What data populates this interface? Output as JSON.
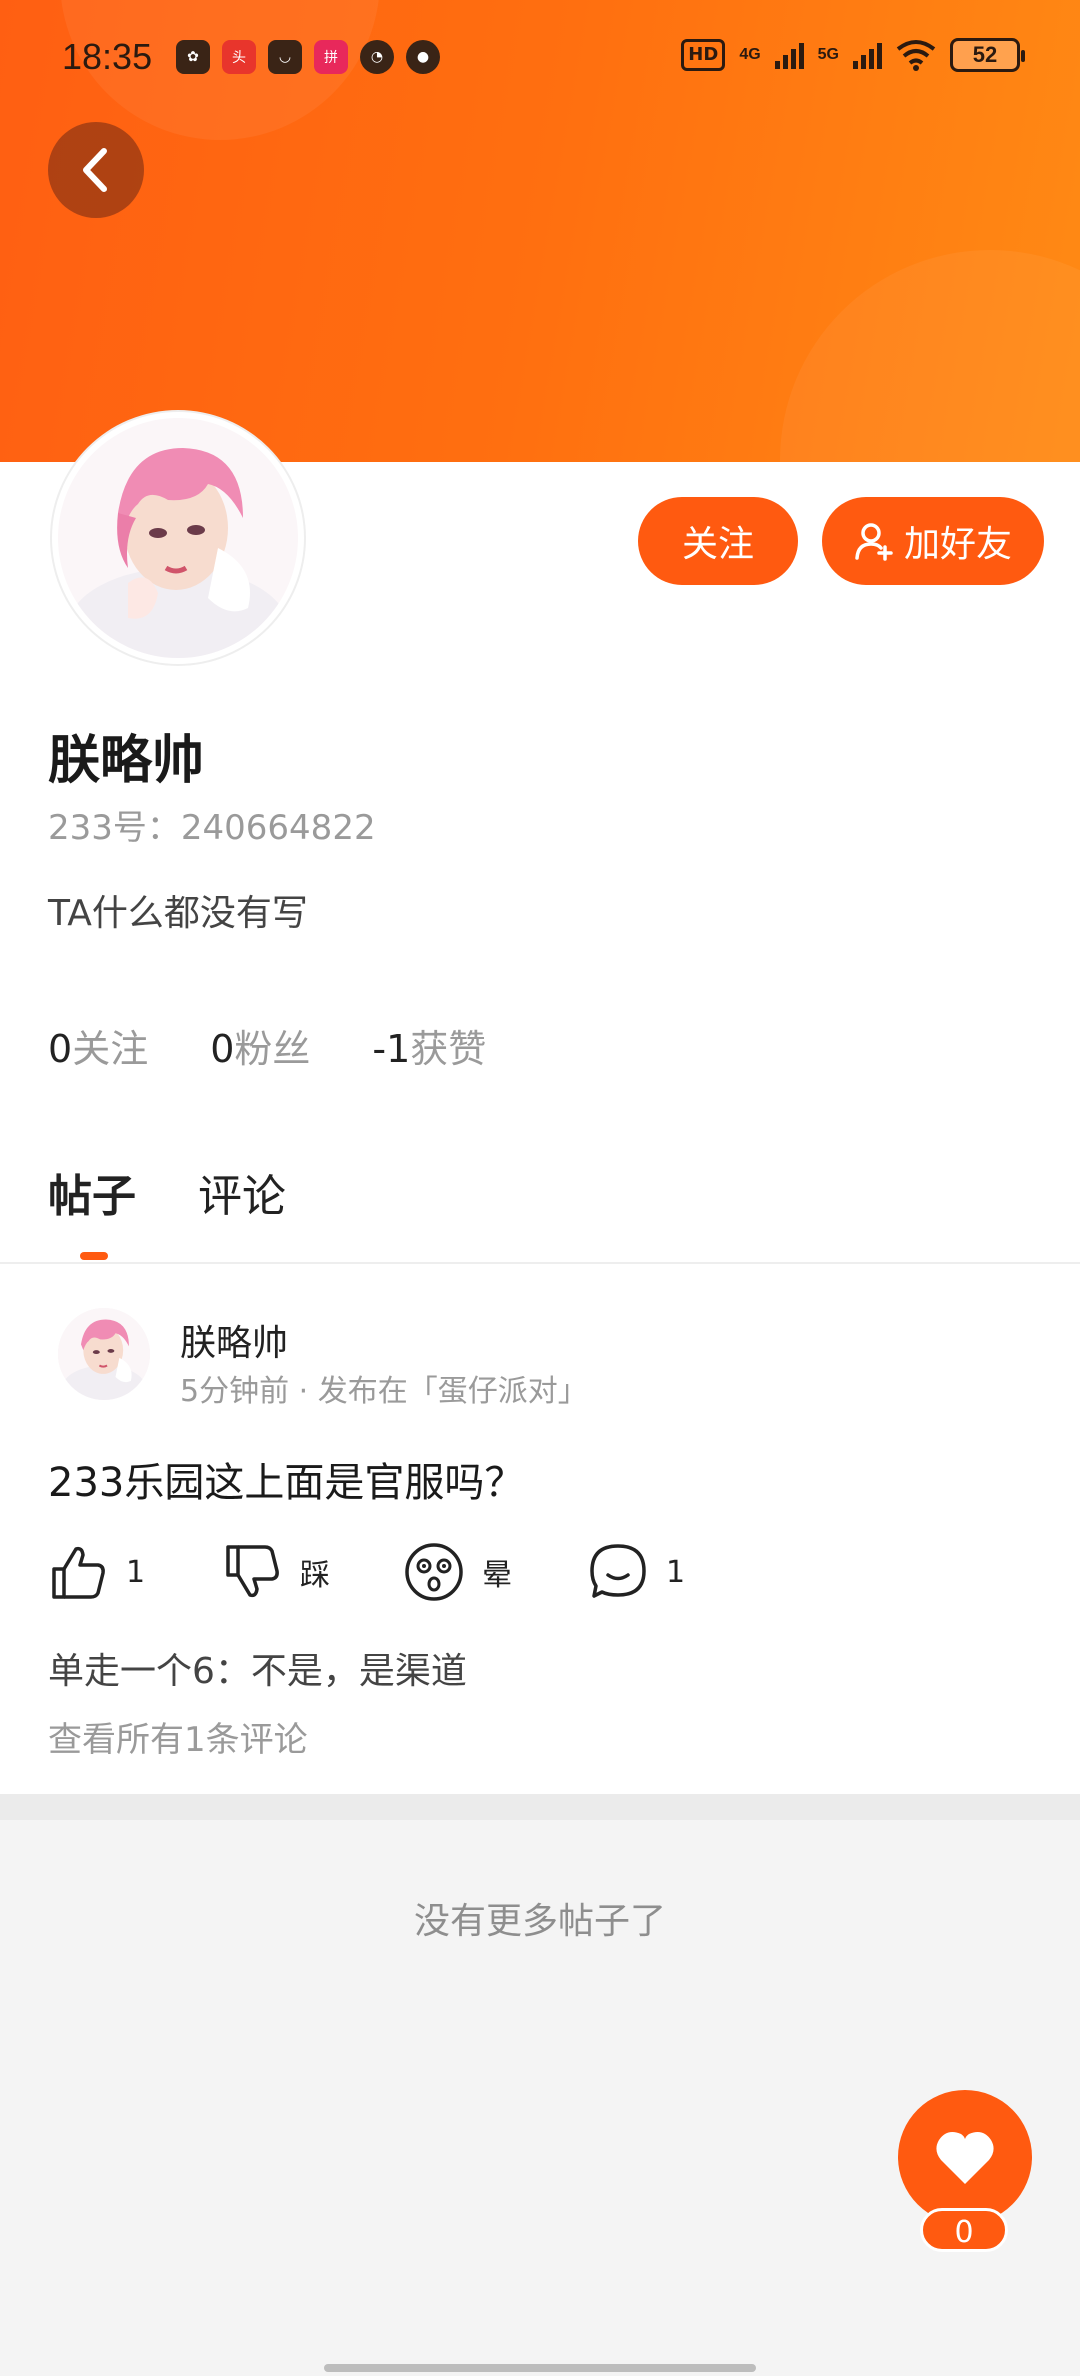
{
  "status_bar": {
    "time": "18:35",
    "app_icons": [
      "遥控",
      "头条",
      "淘宝",
      "拼多多",
      "极速",
      "消息"
    ],
    "hd": "HD",
    "net1": "4G",
    "net2": "5G",
    "battery": "52"
  },
  "header": {
    "back_icon": "chevron-left-icon"
  },
  "profile": {
    "name": "朕略帅",
    "uid": "233号：240664822",
    "bio": "TA什么都没有写",
    "follow_button": "关注",
    "add_friend_button": "加好友",
    "stats": [
      {
        "num": "0",
        "label": "关注"
      },
      {
        "num": "0",
        "label": "粉丝"
      },
      {
        "num": "-1",
        "label": "获赞"
      }
    ]
  },
  "tabs": [
    {
      "label": "帖子",
      "active": true
    },
    {
      "label": "评论",
      "active": false
    }
  ],
  "post": {
    "author": "朕略帅",
    "meta": "5分钟前 · 发布在「蛋仔派对」",
    "text": "233乐园这上面是官服吗？",
    "actions": {
      "like": "1",
      "dislike": "踩",
      "dizzy": "晕",
      "comment": "1"
    },
    "comment_preview": "单走一个6：不是，是渠道",
    "view_all": "查看所有1条评论"
  },
  "footer": {
    "no_more": "没有更多帖子了"
  },
  "fab": {
    "icon": "heart-icon",
    "count": "0"
  },
  "colors": {
    "accent": "#ff5a10",
    "banner": "#ff6f10"
  }
}
